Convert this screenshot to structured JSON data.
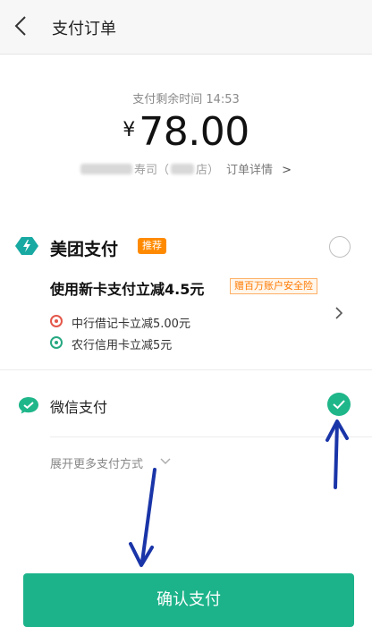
{
  "header": {
    "title": "支付订单"
  },
  "order": {
    "timer_label": "支付剩余时间 14:53",
    "currency_symbol": "¥",
    "amount": "78.00",
    "store_name": "寿司（",
    "store_branch": "店）",
    "detail_link": "订单详情"
  },
  "meituan_pay": {
    "title": "美团支付",
    "badge": "推荐",
    "promo": "使用新卡支付立减4.5元",
    "insurance_tag": "赠百万账户安全险",
    "offers": [
      {
        "text": "中行借记卡立减5.00元",
        "icon": "bank-of-china-icon",
        "color": "#e4574a"
      },
      {
        "text": "农行信用卡立减5元",
        "icon": "agricultural-bank-icon",
        "color": "#26a881"
      }
    ],
    "selected": false
  },
  "wechat_pay": {
    "title": "微信支付",
    "selected": true
  },
  "more_methods": {
    "label": "展开更多支付方式"
  },
  "confirm_button": {
    "label": "确认支付"
  },
  "colors": {
    "accent_green": "#1cb38a",
    "orange": "#ff8a00",
    "meituan_teal": "#17a9a2",
    "annotation_blue": "#1a35a8"
  }
}
